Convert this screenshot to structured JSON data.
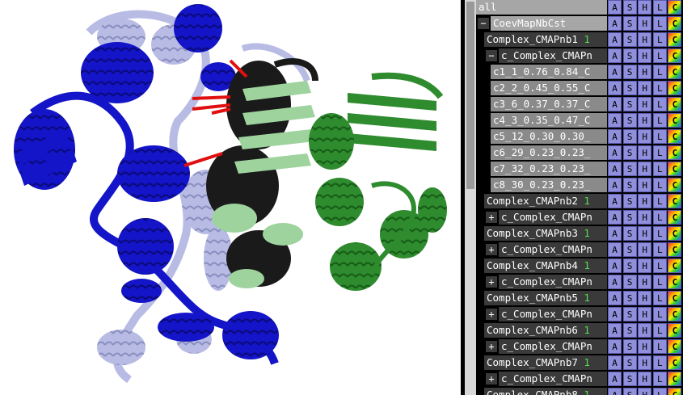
{
  "viewer": {
    "colors": {
      "chain_blue": "#1414c8",
      "chain_lightblue": "#b8bce4",
      "chain_green": "#2e8b2e",
      "chain_lightgreen": "#9ed39e",
      "chain_black": "#1a1a1a",
      "contact_red": "#e01010"
    },
    "description_icon": "protein-cartoon-icon"
  },
  "panel": {
    "buttons": [
      "A",
      "S",
      "H",
      "L",
      "C"
    ],
    "rows": [
      {
        "toggle": "",
        "label": "all",
        "count": "",
        "style": "top"
      },
      {
        "toggle": "−",
        "label": "CoevMapNbCst",
        "count": "",
        "style": "top"
      },
      {
        "toggle": "",
        "label": "Complex_CMAPnb1",
        "count": "1",
        "style": "obj"
      },
      {
        "toggle": "−",
        "label": "c_Complex_CMAPn",
        "count": "",
        "style": "obj"
      },
      {
        "toggle": "",
        "label": "c1_1_0.76_0.84_C",
        "count": "",
        "style": "sub"
      },
      {
        "toggle": "",
        "label": "c2_2_0.45_0.55_C",
        "count": "",
        "style": "sub"
      },
      {
        "toggle": "",
        "label": "c3_6_0.37_0.37_C",
        "count": "",
        "style": "sub"
      },
      {
        "toggle": "",
        "label": "c4_3_0.35_0.47_C",
        "count": "",
        "style": "sub"
      },
      {
        "toggle": "",
        "label": "c5_12_0.30_0.30_",
        "count": "",
        "style": "sub"
      },
      {
        "toggle": "",
        "label": "c6_29_0.23_0.23_",
        "count": "",
        "style": "sub"
      },
      {
        "toggle": "",
        "label": "c7_32_0.23_0.23_",
        "count": "",
        "style": "sub"
      },
      {
        "toggle": "",
        "label": "c8_30_0.23_0.23_",
        "count": "",
        "style": "sub"
      },
      {
        "toggle": "",
        "label": "Complex_CMAPnb2",
        "count": "1",
        "style": "obj"
      },
      {
        "toggle": "+",
        "label": "c_Complex_CMAPn",
        "count": "",
        "style": "obj"
      },
      {
        "toggle": "",
        "label": "Complex_CMAPnb3",
        "count": "1",
        "style": "obj"
      },
      {
        "toggle": "+",
        "label": "c_Complex_CMAPn",
        "count": "",
        "style": "obj"
      },
      {
        "toggle": "",
        "label": "Complex_CMAPnb4",
        "count": "1",
        "style": "obj"
      },
      {
        "toggle": "+",
        "label": "c_Complex_CMAPn",
        "count": "",
        "style": "obj"
      },
      {
        "toggle": "",
        "label": "Complex_CMAPnb5",
        "count": "1",
        "style": "obj"
      },
      {
        "toggle": "+",
        "label": "c_Complex_CMAPn",
        "count": "",
        "style": "obj"
      },
      {
        "toggle": "",
        "label": "Complex_CMAPnb6",
        "count": "1",
        "style": "obj"
      },
      {
        "toggle": "+",
        "label": "c_Complex_CMAPn",
        "count": "",
        "style": "obj"
      },
      {
        "toggle": "",
        "label": "Complex_CMAPnb7",
        "count": "1",
        "style": "obj"
      },
      {
        "toggle": "+",
        "label": "c_Complex_CMAPn",
        "count": "",
        "style": "obj"
      },
      {
        "toggle": "",
        "label": "Complex_CMAPnb8",
        "count": "1",
        "style": "obj"
      }
    ]
  }
}
